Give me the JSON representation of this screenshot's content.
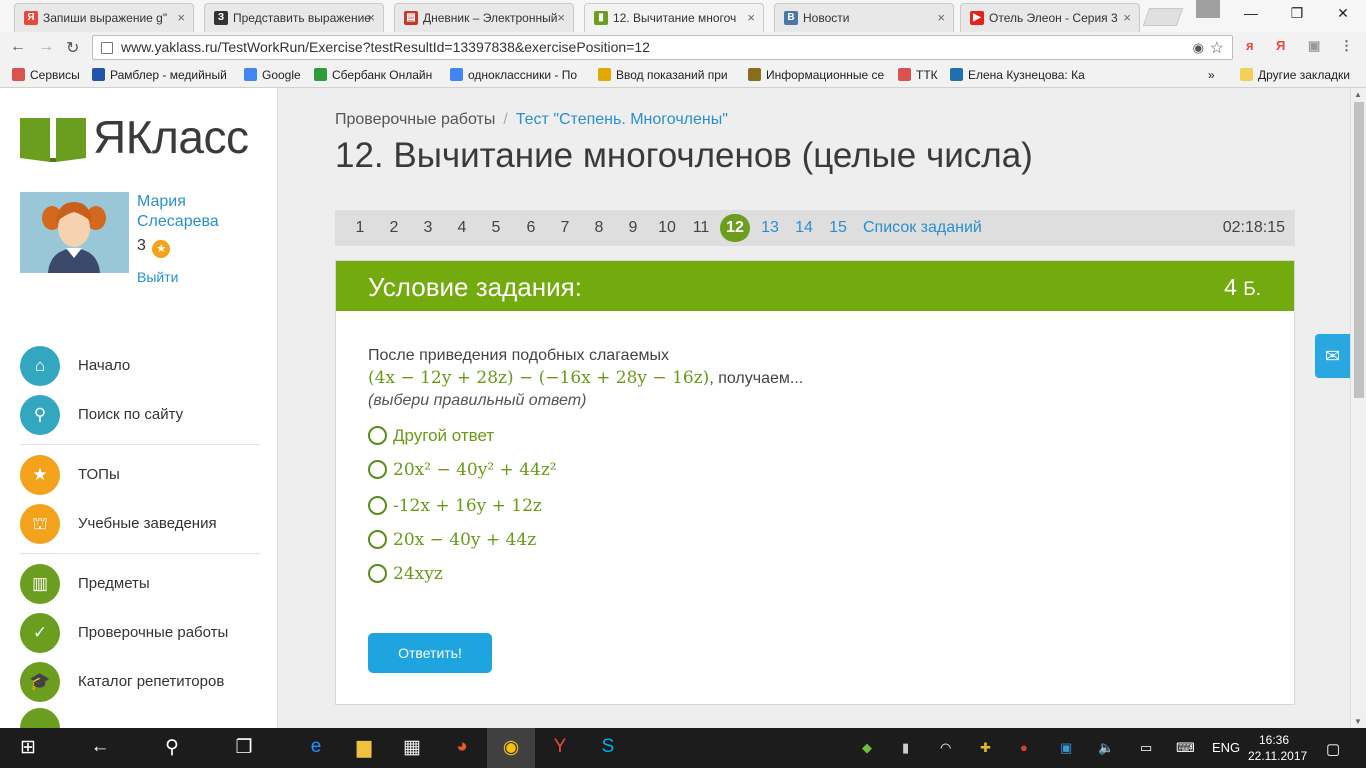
{
  "browser": {
    "tabs": [
      {
        "title": "Запиши выражение g\"",
        "color": "#e8e8e8",
        "favicon": "Я",
        "favicon_color": "#e34a3c"
      },
      {
        "title": "Представить выражение",
        "color": "#e8e8e8",
        "favicon": "З",
        "favicon_color": "#333333"
      },
      {
        "title": "Дневник – Электронный",
        "color": "#e8e8e8",
        "favicon": "▤",
        "favicon_color": "#c0392b"
      },
      {
        "title": "12. Вычитание многоч",
        "color": "#f2f2f2",
        "favicon": "▮",
        "favicon_color": "#6b9e1f"
      },
      {
        "title": "Новости",
        "color": "#e8e8e8",
        "favicon": "В",
        "favicon_color": "#4a76a8"
      },
      {
        "title": "Отель Элеон - Серия 3",
        "color": "#e8e8e8",
        "favicon": "▶",
        "favicon_color": "#e62117"
      }
    ],
    "tab_close": "×",
    "window_buttons": {
      "minimize": "—",
      "maximize": "❐",
      "close": "✕"
    },
    "nav": {
      "back": "←",
      "forward": "→",
      "reload": "↻"
    },
    "url": "www.yaklass.ru/TestWorkRun/Exercise?testResultId=13397838&exercisePosition=12",
    "star": "☆",
    "cam": "◉",
    "extensions": [
      {
        "label": "я",
        "color": "#e34a3c"
      },
      {
        "label": "Я",
        "color": "#e34a3c"
      },
      {
        "label": "▣",
        "color": "#999999"
      },
      {
        "label": "⋮",
        "color": "#555555"
      }
    ],
    "bookmarks": [
      {
        "label": "Сервисы",
        "color": "#d9534f"
      },
      {
        "label": "Рамблер - медийный",
        "color": "#2255aa"
      },
      {
        "label": "Google",
        "color": "#4285f4"
      },
      {
        "label": "Сбербанк Онлайн",
        "color": "#2e9c3a"
      },
      {
        "label": "одноклассники - По",
        "color": "#4285f4"
      },
      {
        "label": "Ввод показаний при",
        "color": "#e0a800"
      },
      {
        "label": "Информационные се",
        "color": "#8a6d1c"
      },
      {
        "label": "ТТК",
        "color": "#d9534f"
      },
      {
        "label": "Елена Кузнецова: Ка",
        "color": "#1f6fb2"
      }
    ],
    "bookmarks_more": "»",
    "other_bookmarks": "Другие закладки"
  },
  "sidebar": {
    "brand": "ЯКласс",
    "user_name": "Мария Слесарева",
    "user_points": "3",
    "points_icon": "★",
    "logout": "Выйти",
    "menu": [
      {
        "label": "Начало",
        "icon": "⌂",
        "icon_name": "home-icon"
      },
      {
        "label": "Поиск по сайту",
        "icon": "⚲",
        "icon_name": "search-icon"
      },
      {
        "label": "ТОПы",
        "icon": "★",
        "icon_name": "star-icon"
      },
      {
        "label": "Учебные заведения",
        "icon": "⛫",
        "icon_name": "institution-icon"
      },
      {
        "label": "Предметы",
        "icon": "▥",
        "icon_name": "book-icon"
      },
      {
        "label": "Проверочные работы",
        "icon": "✓",
        "icon_name": "check-icon"
      },
      {
        "label": "Каталог репетиторов",
        "icon": "🎓",
        "icon_name": "graduation-cap-icon"
      }
    ]
  },
  "main": {
    "breadcrumb": {
      "root": "Проверочные работы",
      "separator": "/",
      "current": "Тест \"Степень. Многочлены\""
    },
    "title": "12. Вычитание многочленов (целые числа)",
    "question_nav": {
      "numbers": [
        "1",
        "2",
        "3",
        "4",
        "5",
        "6",
        "7",
        "8",
        "9",
        "10",
        "11",
        "12",
        "13",
        "14",
        "15"
      ],
      "current": "12",
      "task_list": "Список заданий",
      "timer": "02:18:15"
    },
    "card": {
      "header": "Условие задания:",
      "points_value": "4",
      "points_unit": "Б.",
      "question_text": "После приведения подобных слагаемых",
      "question_expr": "(4x − 12y + 28z) − (−16x + 28y − 16z)",
      "question_suffix": ", получаем...",
      "hint": "(выбери правильный ответ)",
      "options": [
        {
          "text": "Другой ответ",
          "kind": "plain"
        },
        {
          "text": "20x² − 40y² + 44z²",
          "kind": "math"
        },
        {
          "text": "-12x + 16y + 12z",
          "kind": "math"
        },
        {
          "text": "20x − 40y + 44z",
          "kind": "math"
        },
        {
          "text": "24xyz",
          "kind": "math"
        }
      ],
      "submit": "Ответить!"
    },
    "mail_icon": "✉"
  },
  "taskbar": {
    "start": "⊞",
    "back": "←",
    "search": "⚲",
    "task_view": "❐",
    "apps": [
      {
        "label": "e",
        "color": "#1e90ff",
        "name": "edge-icon"
      },
      {
        "label": "▆",
        "color": "#f0c040",
        "name": "explorer-icon"
      },
      {
        "label": "▦",
        "color": "#f0f0f0",
        "name": "store-icon"
      },
      {
        "label": "◕",
        "color": "#e05a2a",
        "name": "paint-icon"
      },
      {
        "label": "◉",
        "color": "#f4c20d",
        "name": "chrome-icon"
      },
      {
        "label": "Y",
        "color": "#e34a3c",
        "name": "yandex-browser-icon"
      },
      {
        "label": "S",
        "color": "#00aff0",
        "name": "skype-icon"
      }
    ],
    "tray": [
      {
        "label": "◆",
        "color": "#6fbf3b",
        "name": "tray-app-icon"
      },
      {
        "label": "▮",
        "color": "#cccccc",
        "name": "usb-icon"
      },
      {
        "label": "◠",
        "color": "#ffffff",
        "name": "wifi-icon"
      },
      {
        "label": "✚",
        "color": "#e0c020",
        "name": "tray-plus-icon"
      },
      {
        "label": "●",
        "color": "#d04040",
        "name": "tray-red-icon"
      },
      {
        "label": "▣",
        "color": "#3a9ad9",
        "name": "tray-blue-icon"
      },
      {
        "label": "🔈",
        "color": "#ffffff",
        "name": "volume-icon"
      },
      {
        "label": "▭",
        "color": "#ffffff",
        "name": "battery-icon"
      },
      {
        "label": "⌨",
        "color": "#ffffff",
        "name": "keyboard-icon"
      }
    ],
    "language": "ENG",
    "time": "16:36",
    "date": "22.11.2017",
    "notifications": "▢"
  },
  "colors": {
    "brand_green": "#73aa0e",
    "link_blue": "#2a8fcf",
    "button_blue": "#1ea5e0"
  }
}
